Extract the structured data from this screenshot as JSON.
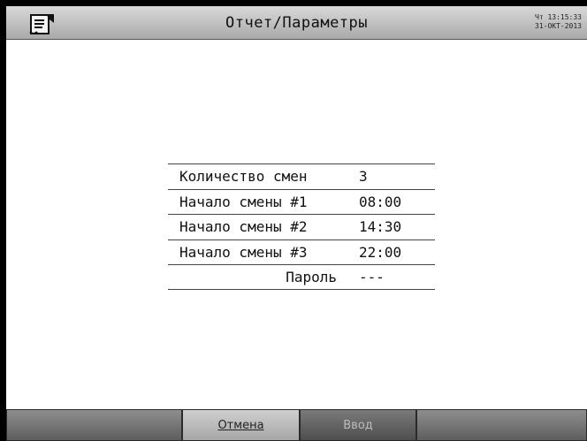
{
  "header": {
    "title": "Отчет/Параметры",
    "clock_line1": "Чт 13:15:33",
    "clock_line2": "31-ОКТ-2013",
    "icon": "report-icon"
  },
  "params": [
    {
      "label": "Количество смен",
      "value": "3",
      "align": "left"
    },
    {
      "label": "Начало смены #1",
      "value": "08:00",
      "align": "left"
    },
    {
      "label": "Начало смены #2",
      "value": "14:30",
      "align": "left"
    },
    {
      "label": "Начало смены #3",
      "value": "22:00",
      "align": "left"
    },
    {
      "label": "Пароль",
      "value": "---",
      "align": "right"
    }
  ],
  "footer": {
    "cancel_label": "Отмена",
    "enter_label": "Ввод"
  }
}
